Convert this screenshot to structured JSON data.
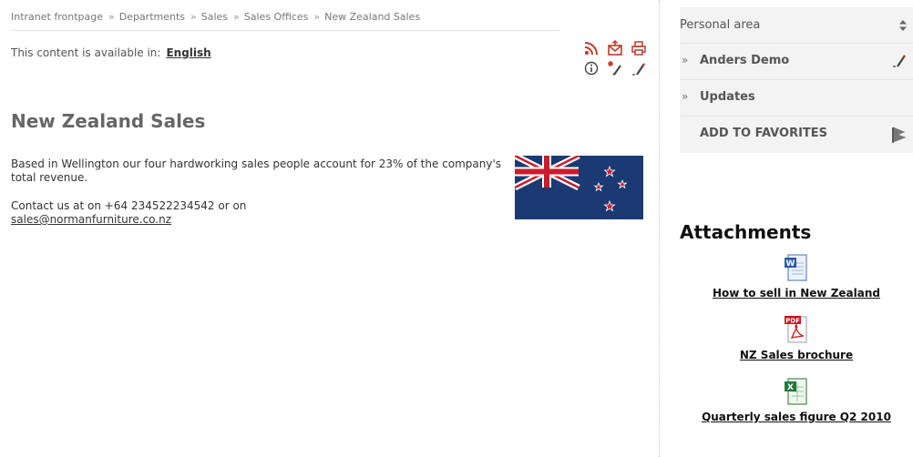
{
  "breadcrumb": {
    "items": [
      "Intranet frontpage",
      "Departments",
      "Sales",
      "Sales Offices",
      "New Zealand Sales"
    ],
    "separator": "»"
  },
  "language": {
    "prefix": "This content is available in:",
    "current": "English"
  },
  "toolbar": {
    "icons": [
      "rss-icon",
      "email-icon",
      "print-icon",
      "info-icon",
      "new-page-icon",
      "edit-icon"
    ],
    "accent": "#c0392b"
  },
  "article": {
    "title": "New Zealand Sales",
    "paragraph1": "Based in Wellington our four hardworking sales people account for 23% of the company's total revenue.",
    "contact_prefix": "Contact us at on +64 234522234542 or on",
    "contact_email": "sales@normanfurniture.co.nz"
  },
  "sidebar": {
    "personal_area": {
      "header": "Personal area",
      "items": [
        {
          "label": "Anders Demo",
          "bullet": "»"
        },
        {
          "label": "Updates",
          "bullet": "»"
        }
      ],
      "favorites_label": "ADD TO FAVORITES"
    },
    "attachments": {
      "title": "Attachments",
      "files": [
        {
          "label": "How to sell in New Zealand",
          "icon": "word-icon"
        },
        {
          "label": "NZ Sales brochure",
          "icon": "pdf-icon"
        },
        {
          "label": "Quarterly sales figure Q2 2010",
          "icon": "excel-icon"
        }
      ]
    }
  },
  "colors": {
    "flag_blue": "#1b3a73",
    "flag_red": "#cc1b2b",
    "panel_bg": "#f3f3f3"
  }
}
